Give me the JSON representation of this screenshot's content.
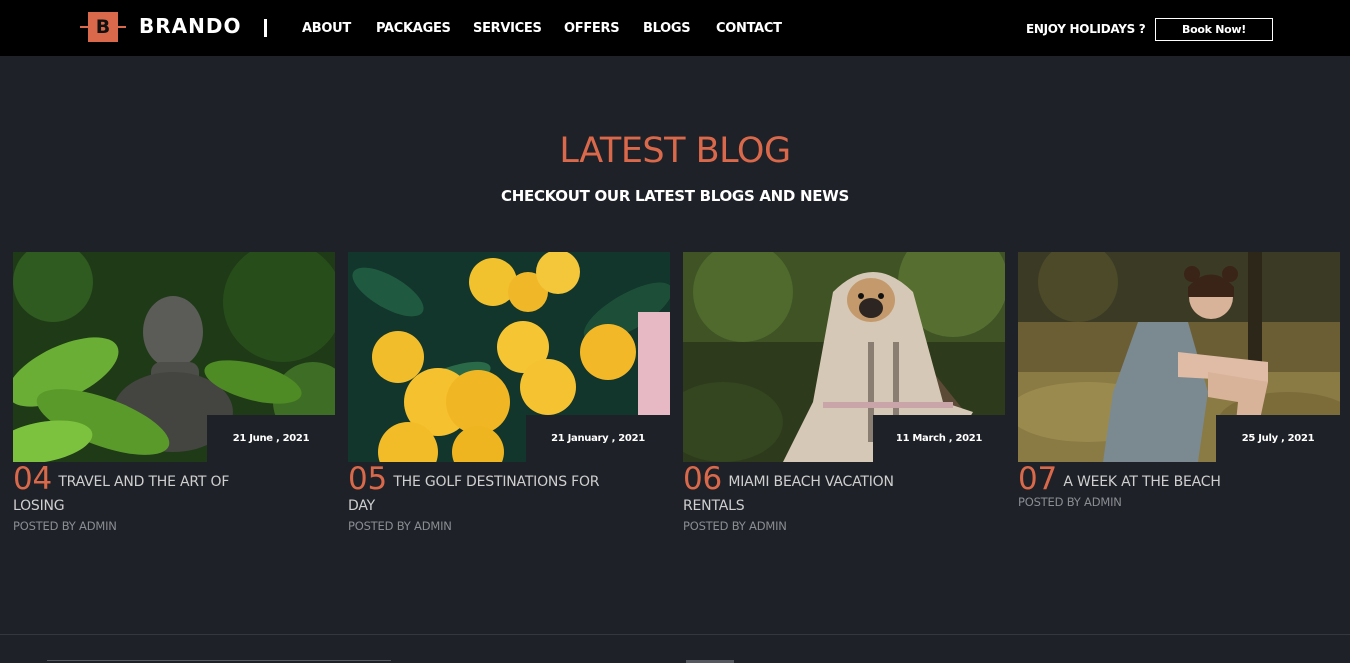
{
  "nav": {
    "logo_letter": "B",
    "brand": "BRANDO",
    "links": [
      "ABOUT",
      "PACKAGES",
      "SERVICES",
      "OFFERS",
      "BLOGS",
      "CONTACT"
    ],
    "tagline": "ENJOY HOLIDAYS ?",
    "cta_label": "Book Now!"
  },
  "colors": {
    "accent": "#d9694a",
    "background": "#1e2127",
    "navbar": "#000000"
  },
  "section": {
    "title": "LATEST BLOG",
    "subtitle": "CHECKOUT OUR LATEST BLOGS AND NEWS"
  },
  "posts": [
    {
      "number": "04",
      "title": "TRAVEL AND THE ART OF LOSING",
      "date": "21 June , 2021",
      "author": "POSTED BY ADMIN",
      "image": "buddha-statue-among-leaves"
    },
    {
      "number": "05",
      "title": "THE GOLF DESTINATIONS FOR DAY",
      "date": "21 January , 2021",
      "author": "POSTED BY ADMIN",
      "image": "lemons-on-tree"
    },
    {
      "number": "06",
      "title": "MIAMI BEACH VACATION RENTALS",
      "date": "11 March , 2021",
      "author": "POSTED BY ADMIN",
      "image": "pug-in-blanket"
    },
    {
      "number": "07",
      "title": "A WEEK AT THE BEACH",
      "date": "25 July , 2021",
      "author": "POSTED BY ADMIN",
      "image": "woman-sitting-in-field"
    }
  ]
}
